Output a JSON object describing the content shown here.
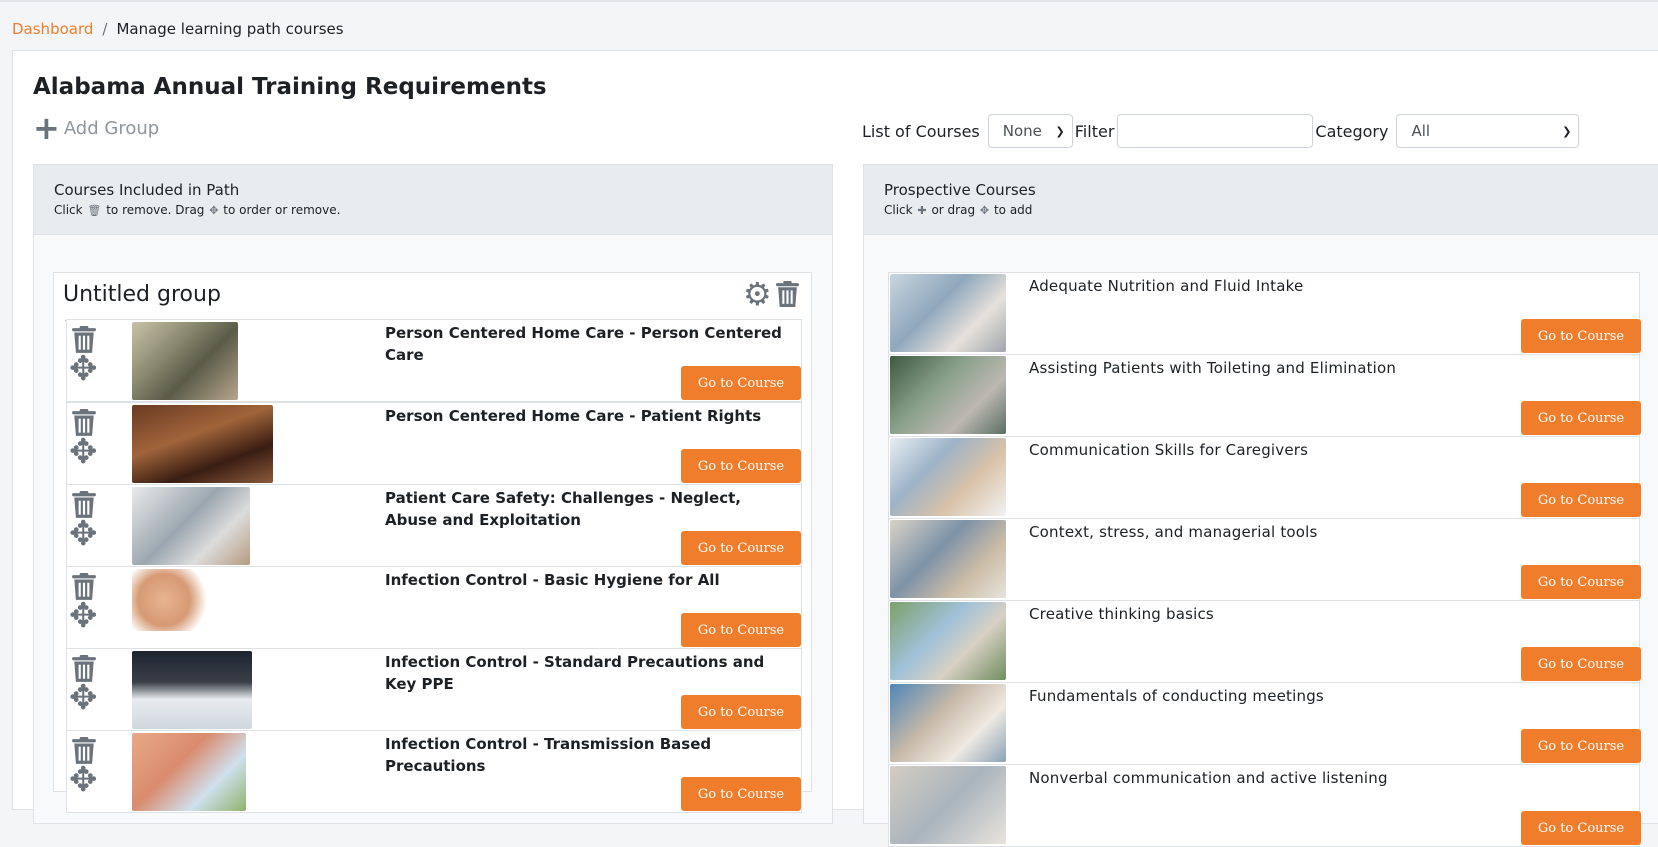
{
  "breadcrumb": {
    "home": "Dashboard",
    "separator": "/",
    "current": "Manage learning path courses"
  },
  "page": {
    "title": "Alabama Annual Training Requirements",
    "add_group": "Add Group"
  },
  "controls": {
    "list_label": "List of Courses",
    "list_value": "None",
    "filter_label": "Filter",
    "filter_value": "",
    "category_label": "Category",
    "category_value": "All"
  },
  "included": {
    "title": "Courses Included in Path",
    "instr_1": "Click",
    "instr_2": "to remove. Drag",
    "instr_3": "to order or remove.",
    "group_title": "Untitled group",
    "courses": [
      {
        "title": "Person Centered Home Care - Person Centered Care",
        "button": "Go to Course"
      },
      {
        "title": "Person Centered Home Care - Patient Rights",
        "button": "Go to Course"
      },
      {
        "title": "Patient Care Safety: Challenges - Neglect, Abuse and Exploitation",
        "button": "Go to Course"
      },
      {
        "title": "Infection Control - Basic Hygiene for All",
        "button": "Go to Course"
      },
      {
        "title": "Infection Control - Standard Precautions and Key PPE",
        "button": "Go to Course"
      },
      {
        "title": "Infection Control - Transmission Based Precautions",
        "button": "Go to Course"
      }
    ]
  },
  "prospective": {
    "title": "Prospective Courses",
    "instr_1": "Click",
    "instr_2": "or drag",
    "instr_3": "to add",
    "courses": [
      {
        "title": "Adequate Nutrition and Fluid Intake",
        "button": "Go to Course"
      },
      {
        "title": "Assisting Patients with Toileting and Elimination",
        "button": "Go to Course"
      },
      {
        "title": "Communication Skills for Caregivers",
        "button": "Go to Course"
      },
      {
        "title": "Context, stress, and managerial tools",
        "button": "Go to Course"
      },
      {
        "title": "Creative thinking basics",
        "button": "Go to Course"
      },
      {
        "title": "Fundamentals of conducting meetings",
        "button": "Go to Course"
      },
      {
        "title": "Nonverbal communication and active listening",
        "button": "Go to Course"
      }
    ]
  },
  "thumbnail_images": {
    "included": [
      "caregiver-with-elderly-woman",
      "gavel-human-rights",
      "neglect-word-cloud",
      "hands-with-germs",
      "woman-wearing-face-mask",
      "nose-with-virus-particles"
    ],
    "prospective": [
      "nurse-helping-elderly-woman",
      "caregiver-with-patient",
      "nurse-talking-to-elderly-man",
      "doctor-with-elderly-couple",
      "group-of-seniors-and-nurse",
      "nurse-assisting-patient-in-bed",
      "caregiver-photo"
    ]
  },
  "colors": {
    "accent": "#f07d2c",
    "icon_gray": "#6a737b"
  }
}
